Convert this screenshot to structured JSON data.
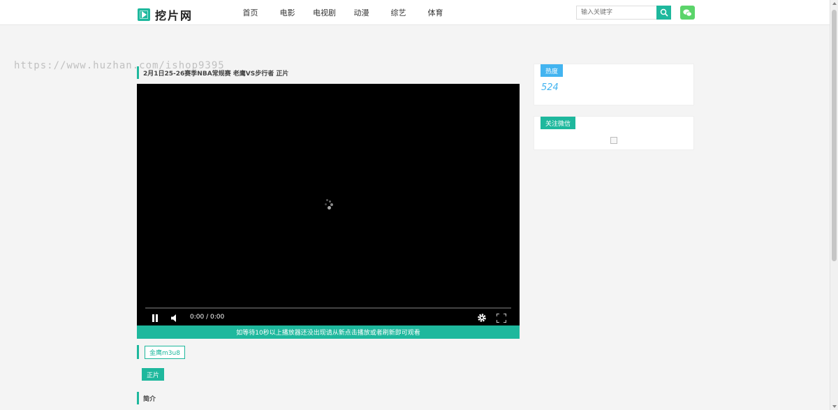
{
  "header": {
    "logo_text": "挖片网",
    "nav": [
      "首页",
      "电影",
      "电视剧",
      "动漫",
      "综艺",
      "体育"
    ],
    "search_placeholder": "输入关键字"
  },
  "watermark": "https://www.huzhan.com/ishop9395",
  "video": {
    "title": "2月1日25-26赛季NBA常规赛 老鹰VS步行者 正片",
    "time": "0:00 / 0:00",
    "notice": "如等待10秒以上播放器还没出现请从新点击播放或者刷新即可观看"
  },
  "source": {
    "label": "金鹰m3u8",
    "episode": "正片"
  },
  "intro_heading": "简介",
  "sidebar": {
    "hot_label": "热度",
    "hot_count": "524",
    "wechat_label": "关注微信"
  },
  "colors": {
    "accent": "#1eb89d",
    "hot": "#43b4f0",
    "wechat": "#5bd46a"
  }
}
